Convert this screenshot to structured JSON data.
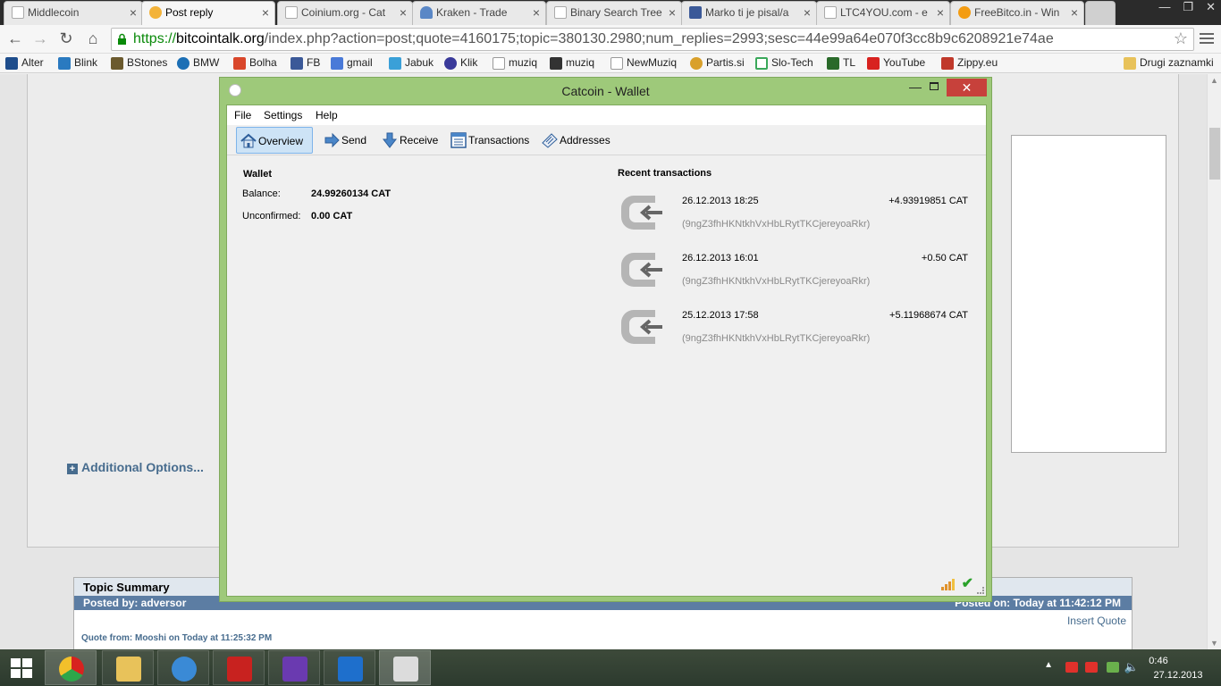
{
  "browser": {
    "tabs": [
      {
        "label": "Middlecoin",
        "color": "#ffffff"
      },
      {
        "label": "Post reply",
        "color": "#f3b33a"
      },
      {
        "label": "Coinium.org - Cat",
        "color": "#ffffff"
      },
      {
        "label": "Kraken - Trade",
        "color": "#5a87c6"
      },
      {
        "label": "Binary Search Tree",
        "color": "#ffffff"
      },
      {
        "label": "Marko ti je pisal/a",
        "color": "#3b5998"
      },
      {
        "label": "LTC4YOU.com - e",
        "color": "#ffffff"
      },
      {
        "label": "FreeBitco.in - Win",
        "color": "#f39c12"
      }
    ],
    "url_scheme": "https://",
    "url_host": "bitcointalk.org",
    "url_rest": "/index.php?action=post;quote=4160175;topic=380130.2980;num_replies=2993;sesc=44e99a64e070f3cc8b9c6208921e74ae",
    "bookmarks": [
      {
        "label": "Alter",
        "color": "#1e4d8c"
      },
      {
        "label": "Blink",
        "color": "#2a7ac0"
      },
      {
        "label": "BStones",
        "color": "#6b5a2e"
      },
      {
        "label": "BMW",
        "color": "#1c6fb5"
      },
      {
        "label": "Bolha",
        "color": "#d9472b"
      },
      {
        "label": "FB",
        "color": "#3b5998"
      },
      {
        "label": "gmail",
        "color": "#4a7ad8"
      },
      {
        "label": "Jabuk",
        "color": "#3aa0d8"
      },
      {
        "label": "Klik",
        "color": "#3a3a9a"
      },
      {
        "label": "muziq",
        "color": "#ffffff"
      },
      {
        "label": "muziq",
        "color": "#333333"
      },
      {
        "label": "NewMuziq",
        "color": "#ffffff"
      },
      {
        "label": "Partis.si",
        "color": "#d9a02b"
      },
      {
        "label": "Slo-Tech",
        "color": "#3aa85a"
      },
      {
        "label": "TL",
        "color": "#2a6a2a"
      },
      {
        "label": "YouTube",
        "color": "#d8221f"
      },
      {
        "label": "Zippy.eu",
        "color": "#c0392b"
      }
    ],
    "other_bookmarks": "Drugi zaznamki"
  },
  "page": {
    "additional_options": "Additional Options...",
    "topic_summary": "Topic Summary",
    "posted_by": "Posted by: adversor",
    "posted_on": "Posted on: Today at 11:42:12 PM",
    "insert_quote": "Insert Quote",
    "quote_from": "Quote from: Mooshi on Today at 11:25:32 PM"
  },
  "wallet": {
    "title": "Catcoin - Wallet",
    "menu": [
      "File",
      "Settings",
      "Help"
    ],
    "toolbar": [
      {
        "label": "Overview",
        "icon": "home-icon",
        "active": true
      },
      {
        "label": "Send",
        "icon": "send-arrow-icon",
        "active": false
      },
      {
        "label": "Receive",
        "icon": "receive-arrow-icon",
        "active": false
      },
      {
        "label": "Transactions",
        "icon": "list-icon",
        "active": false
      },
      {
        "label": "Addresses",
        "icon": "addressbook-icon",
        "active": false
      }
    ],
    "overview": {
      "heading": "Wallet",
      "balance_label": "Balance:",
      "balance_value": "24.99260134 CAT",
      "unconfirmed_label": "Unconfirmed:",
      "unconfirmed_value": "0.00 CAT"
    },
    "recent_heading": "Recent transactions",
    "transactions": [
      {
        "date": "26.12.2013 18:25",
        "amount": "+4.93919851 CAT",
        "address": "(9ngZ3fhHKNtkhVxHbLRytTKCjereyoaRkr)"
      },
      {
        "date": "26.12.2013 16:01",
        "amount": "+0.50 CAT",
        "address": "(9ngZ3fhHKNtkhVxHbLRytTKCjereyoaRkr)"
      },
      {
        "date": "25.12.2013 17:58",
        "amount": "+5.11968674 CAT",
        "address": "(9ngZ3fhHKNtkhVxHbLRytTKCjereyoaRkr)"
      }
    ]
  },
  "taskbar": {
    "time": "0:46",
    "date": "27.12.2013",
    "apps": [
      {
        "name": "chrome",
        "color": "#e0a52a"
      },
      {
        "name": "file-explorer",
        "color": "#e8c25a"
      },
      {
        "name": "bluestacks",
        "color": "#3a8ad6"
      },
      {
        "name": "acrobat",
        "color": "#c8221f"
      },
      {
        "name": "visual-studio",
        "color": "#6a3ab0"
      },
      {
        "name": "teamviewer",
        "color": "#1e6fcc"
      },
      {
        "name": "catcoin-wallet",
        "color": "#dcdcdc"
      }
    ]
  }
}
